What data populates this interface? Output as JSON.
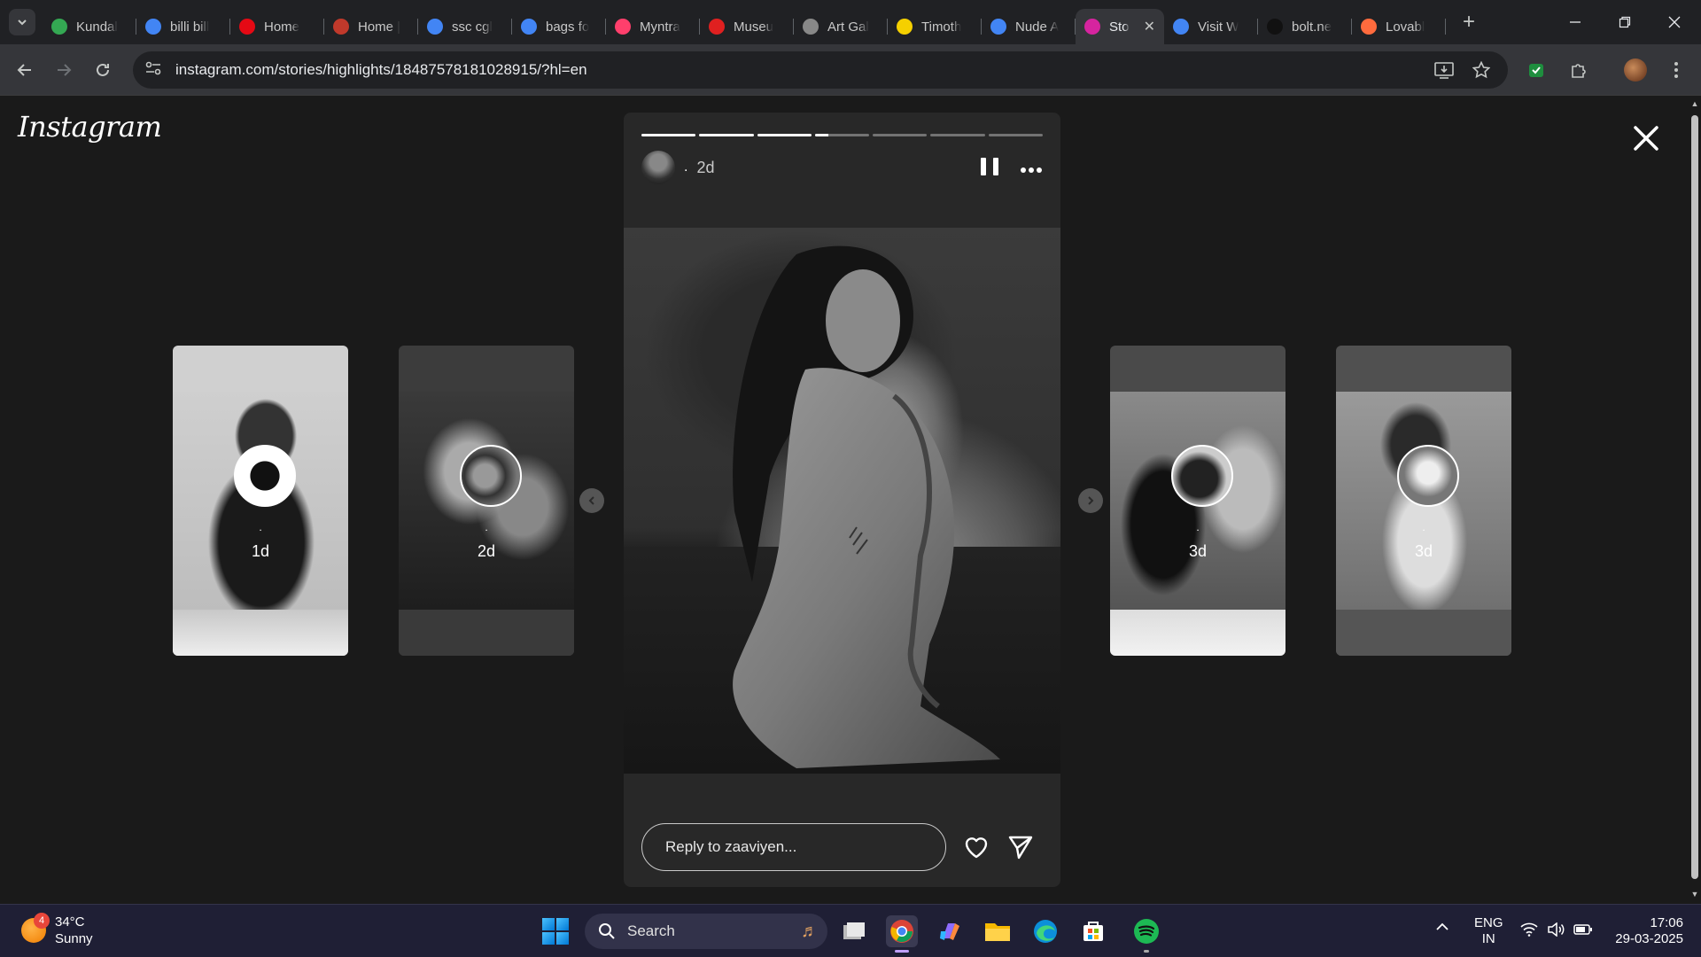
{
  "browser": {
    "tabs": [
      {
        "title": "Kundal",
        "favicon": "maps-pin-icon",
        "color": "#34a853"
      },
      {
        "title": "billi bill",
        "favicon": "google-icon",
        "color": "#4285f4"
      },
      {
        "title": "Home",
        "favicon": "netflix-icon",
        "color": "#e50914"
      },
      {
        "title": "Home |",
        "favicon": "museum-icon",
        "color": "#c0392b"
      },
      {
        "title": "ssc cgl",
        "favicon": "google-icon",
        "color": "#4285f4"
      },
      {
        "title": "bags fo",
        "favicon": "google-icon",
        "color": "#4285f4"
      },
      {
        "title": "Myntra",
        "favicon": "myntra-icon",
        "color": "#ff3f6c"
      },
      {
        "title": "Museu",
        "favicon": "asterisk-icon",
        "color": "#e02020"
      },
      {
        "title": "Art Gal",
        "favicon": "openai-icon",
        "color": "#888888"
      },
      {
        "title": "Timoth",
        "favicon": "mask-icon",
        "color": "#f5d000"
      },
      {
        "title": "Nude A",
        "favicon": "google-icon",
        "color": "#4285f4"
      },
      {
        "title": "Sto",
        "favicon": "instagram-icon",
        "color": "#d6249f",
        "active": true
      },
      {
        "title": "Visit W",
        "favicon": "google-icon",
        "color": "#4285f4"
      },
      {
        "title": "bolt.ne",
        "favicon": "bolt-icon",
        "color": "#111111"
      },
      {
        "title": "Lovabl",
        "favicon": "lovable-heart-icon",
        "color": "#ff6b3d"
      }
    ],
    "url": "instagram.com/stories/highlights/18487578181028915/?hl=en"
  },
  "instagram": {
    "logo": "Instagram",
    "story": {
      "username": ".",
      "time": "2d",
      "progress": [
        1,
        1,
        1,
        0.25,
        0,
        0,
        0
      ],
      "reply_placeholder": "Reply to zaaviyen..."
    },
    "side_stories": [
      {
        "dot": ".",
        "time": "1d"
      },
      {
        "dot": ".",
        "time": "2d"
      },
      {
        "dot": ".",
        "time": "3d"
      },
      {
        "dot": ".",
        "time": "3d"
      }
    ]
  },
  "taskbar": {
    "weather_temp": "34°C",
    "weather_desc": "Sunny",
    "weather_badge": "4",
    "search_label": "Search",
    "lang_line1": "ENG",
    "lang_line2": "IN",
    "time": "17:06",
    "date": "29-03-2025"
  }
}
